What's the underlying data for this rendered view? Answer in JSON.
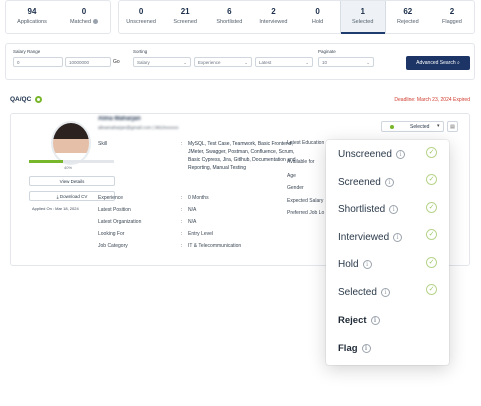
{
  "stats_left": [
    {
      "count": "94",
      "label": "Applications"
    },
    {
      "count": "0",
      "label": "Matched"
    }
  ],
  "stats_right": [
    {
      "count": "0",
      "label": "Unscreened"
    },
    {
      "count": "21",
      "label": "Screened"
    },
    {
      "count": "6",
      "label": "Shortlisted"
    },
    {
      "count": "2",
      "label": "Interviewed"
    },
    {
      "count": "0",
      "label": "Hold"
    },
    {
      "count": "1",
      "label": "Selected"
    },
    {
      "count": "62",
      "label": "Rejected"
    },
    {
      "count": "2",
      "label": "Flagged"
    }
  ],
  "filters": {
    "salary_range_label": "Salary Range",
    "salary_min": "0",
    "salary_max": "10000000",
    "go_label": "Go",
    "sorting_label": "Sorting",
    "sort_salary": "Salary",
    "sort_experience": "Experience",
    "sort_latest": "Latest",
    "paginate_label": "Paginate",
    "paginate_value": "10",
    "advanced_search_label": "Advanced Search"
  },
  "section": {
    "title": "QA/QC",
    "deadline": "Deadline: March 23, 2024 Expired"
  },
  "candidate": {
    "name": "Alina Maharjan",
    "email": "alinamaharjan@gmail.com | 9810xxxxxx",
    "profile_pct": 40,
    "profile_pct_text": "40%",
    "view_details": "View Details",
    "download_cv": "Download CV",
    "applied_on": "Applied On : Mar 18, 2024",
    "skill_label": "Skill",
    "skill_value": "MySQL, Test Case, Teamwork, Basic Frontend, JMeter, Swagger, Postman, Confluence, Scrum, Basic Cypress, Jira, Gitlhub, Documentation and Reporting, Manual Testing",
    "experience_label": "Experience",
    "experience_value": "0 Months",
    "latest_position_label": "Latest Position",
    "latest_position_value": "N/A",
    "latest_org_label": "Latest Organization",
    "latest_org_value": "N/A",
    "looking_for_label": "Looking For",
    "looking_for_value": "Entry Level",
    "job_category_label": "Job Category",
    "job_category_value": "IT & Telecommunication",
    "right_labels": [
      "Latest Education",
      "Available for",
      "Age",
      "Gender",
      "Expected Salary",
      "Preferred Job Lo"
    ],
    "status_value": "Selected"
  },
  "status_menu": [
    {
      "label": "Unscreened",
      "checked": true
    },
    {
      "label": "Screened",
      "checked": true
    },
    {
      "label": "Shortlisted",
      "checked": true
    },
    {
      "label": "Interviewed",
      "checked": true
    },
    {
      "label": "Hold",
      "checked": true
    },
    {
      "label": "Selected",
      "checked": true
    },
    {
      "label": "Reject",
      "checked": false
    },
    {
      "label": "Flag",
      "checked": false
    }
  ],
  "colors": {
    "primary": "#1d3566",
    "accent_green": "#78b72b",
    "deadline_red": "#d03b2e"
  }
}
